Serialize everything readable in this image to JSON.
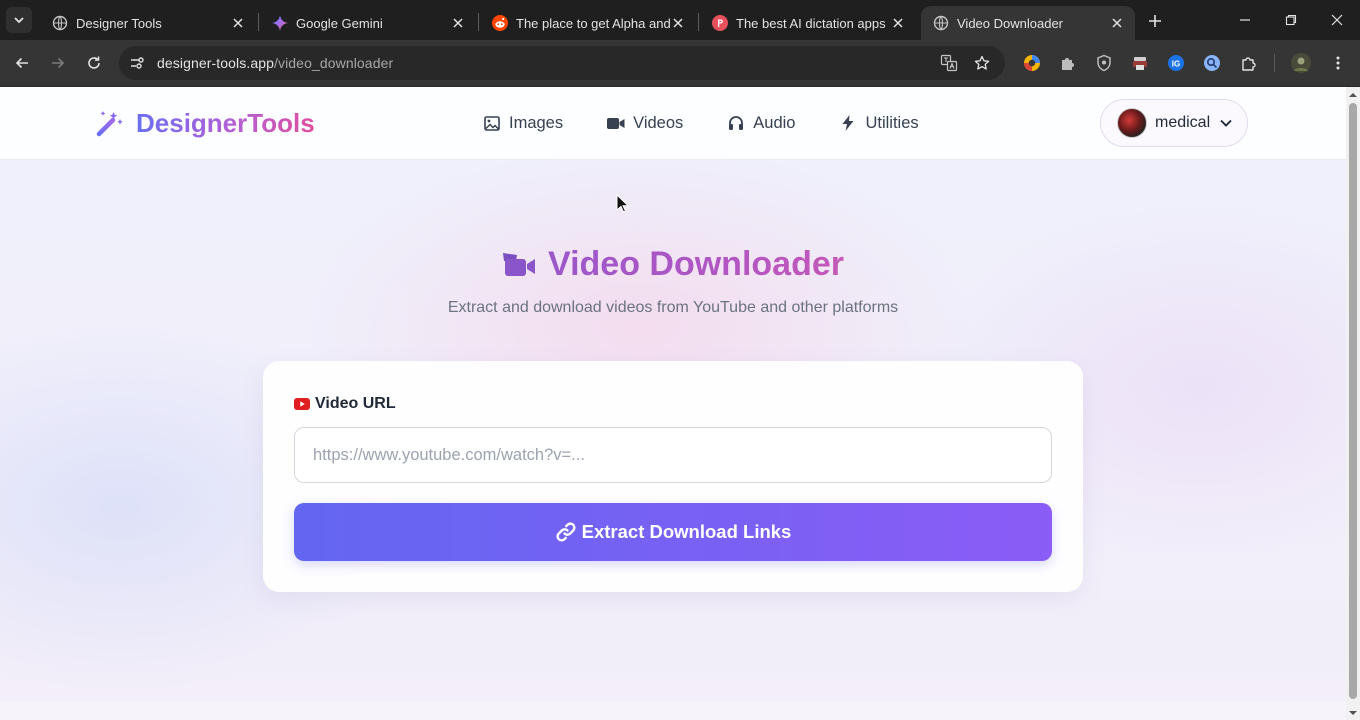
{
  "browser": {
    "tabs": [
      {
        "title": "Designer Tools",
        "icon": "globe-icon",
        "active": false
      },
      {
        "title": "Google Gemini",
        "icon": "gemini-icon",
        "active": false
      },
      {
        "title": "The place to get Alpha and Beta",
        "icon": "reddit-icon",
        "active": false
      },
      {
        "title": "The best AI dictation apps in",
        "icon": "product-hunt-icon",
        "active": false
      },
      {
        "title": "Video Downloader",
        "icon": "globe-icon",
        "active": true
      }
    ],
    "url_host": "designer-tools.app",
    "url_path": "/video_downloader"
  },
  "site": {
    "brand": "DesignerTools",
    "nav": [
      {
        "label": "Images",
        "icon": "image-icon"
      },
      {
        "label": "Videos",
        "icon": "video-camera-icon"
      },
      {
        "label": "Audio",
        "icon": "headphones-icon"
      },
      {
        "label": "Utilities",
        "icon": "bolt-icon"
      }
    ],
    "user": {
      "name": "medical"
    }
  },
  "hero": {
    "title": "Video Downloader",
    "subtitle": "Extract and download videos from YouTube and other platforms"
  },
  "form": {
    "label": "Video URL",
    "input_value": "",
    "input_placeholder": "https://www.youtube.com/watch?v=...",
    "button_label": "Extract Download Links"
  },
  "colors": {
    "brand_start": "#6b6ff2",
    "brand_end": "#df4f9f",
    "title_purple": "#a656c7",
    "button_start": "#6366f1",
    "button_end": "#8b5cf6",
    "youtube_red": "#e02020"
  }
}
